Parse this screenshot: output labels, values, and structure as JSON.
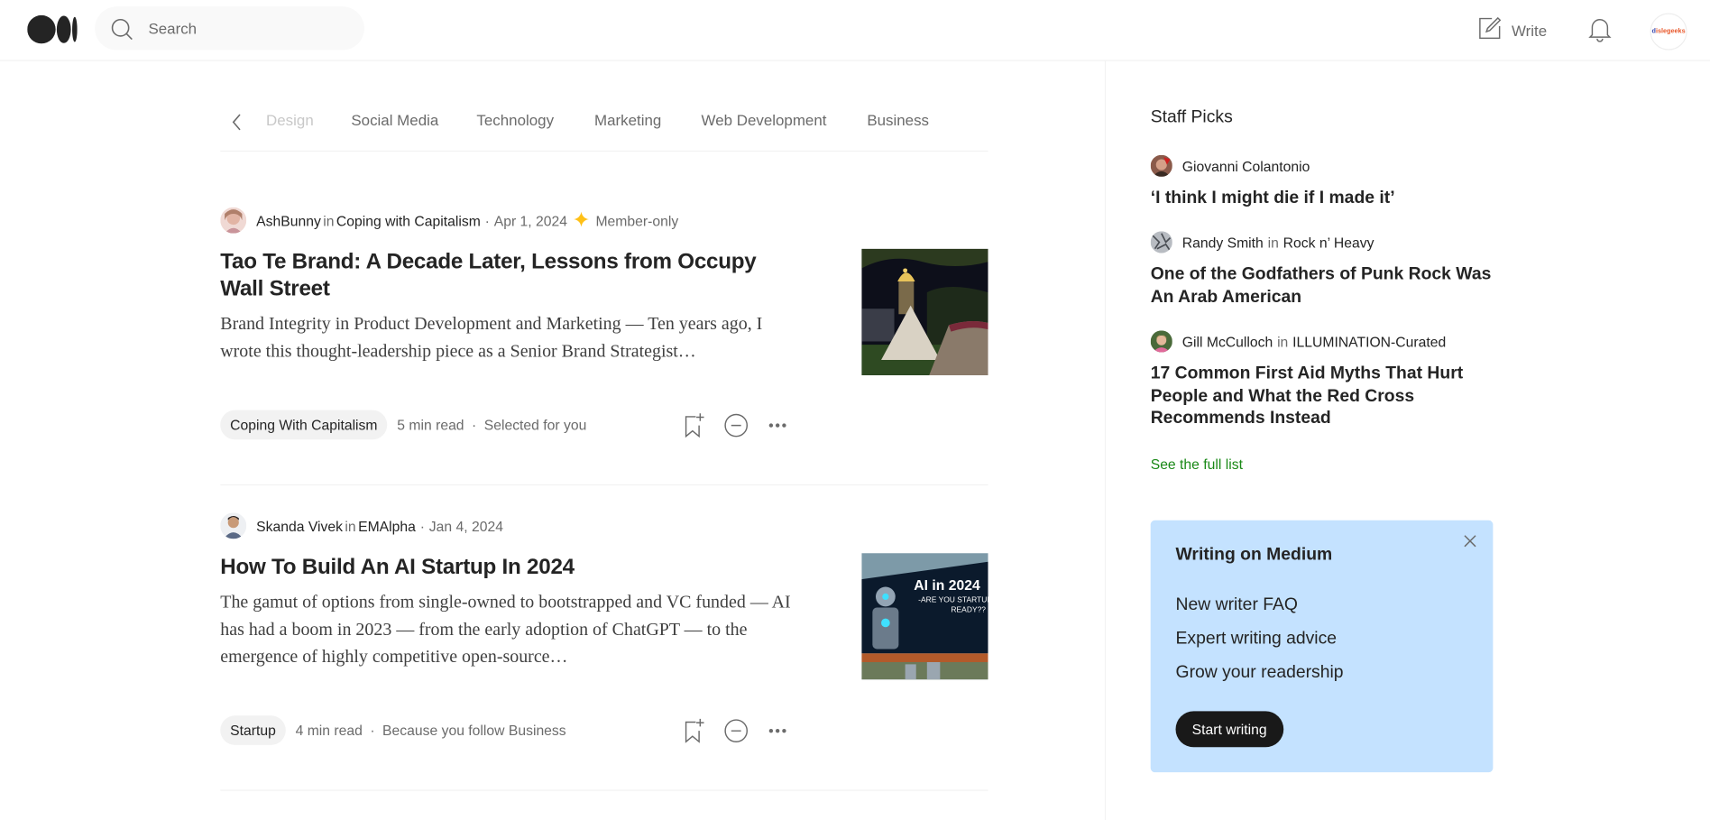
{
  "header": {
    "logo": "medium-logo",
    "search_placeholder": "Search",
    "write_label": "Write",
    "avatar_text_blue": "d",
    "avatar_text_orange": "islegeeks"
  },
  "topics": [
    "Design",
    "Social Media",
    "Technology",
    "Marketing",
    "Web Development",
    "Business"
  ],
  "articles": [
    {
      "author": "AshBunny",
      "in_label": "in",
      "publication": "Coping with Capitalism",
      "date": "Apr 1, 2024",
      "member_only": "Member-only",
      "title": "Tao Te Brand: A Decade Later, Lessons from Occupy Wall Street",
      "excerpt": "Brand Integrity in Product Development and Marketing — Ten years ago, I wrote this thought-leadership piece as a Senior Brand Strategist…",
      "tag": "Coping With Capitalism",
      "read_time": "5 min read",
      "reason": "Selected for you",
      "thumbnail": "night capitol dome with tents"
    },
    {
      "author": "Skanda Vivek",
      "in_label": "in",
      "publication": "EMAlpha",
      "date": "Jan 4, 2024",
      "title": "How To Build An AI Startup In 2024",
      "excerpt": "The gamut of options from single-owned to bootstrapped and VC funded — AI has had a boom in 2023 — from the early adoption of ChatGPT — to the emergence of highly competitive open-source…",
      "tag": "Startup",
      "read_time": "4 min read",
      "reason": "Because you follow Business",
      "thumbnail_text1": "AI in 2024",
      "thumbnail_text2": "-ARE YOU STARTUP",
      "thumbnail_text3": "READY??"
    }
  ],
  "sidebar": {
    "heading": "Staff Picks",
    "picks": [
      {
        "author": "Giovanni Colantonio",
        "title": "‘I think I might die if I made it’"
      },
      {
        "author": "Randy Smith",
        "in_label": "in",
        "publication": "Rock n’ Heavy",
        "title": "One of the Godfathers of Punk Rock Was An Arab American"
      },
      {
        "author": "Gill McCulloch",
        "in_label": "in",
        "publication": "ILLUMINATION-Curated",
        "title": "17 Common First Aid Myths That Hurt People and What the Red Cross Recommends Instead"
      }
    ],
    "see_full_list": "See the full list",
    "writing_box": {
      "heading": "Writing on Medium",
      "links": [
        "New writer FAQ",
        "Expert writing advice",
        "Grow your readership"
      ],
      "button": "Start writing"
    }
  },
  "colors": {
    "accent_green": "#1a8917",
    "writing_box_bg": "#c4e2ff",
    "member_star": "#ffc017",
    "text_primary": "#242424",
    "text_secondary": "#6b6b6b"
  }
}
